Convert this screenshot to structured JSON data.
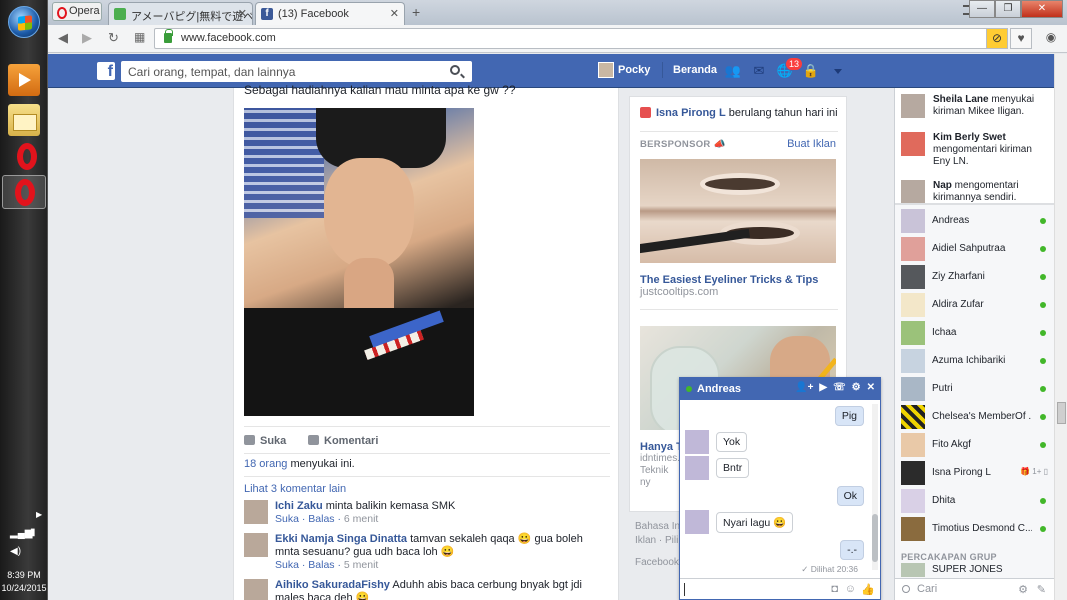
{
  "taskbar": {
    "time": "8:39 PM",
    "date": "10/24/2015"
  },
  "browser": {
    "menu_label": "Opera",
    "tabs": [
      {
        "title": "アメーバピグ|無料で遊べ"
      },
      {
        "title": "(13) Facebook"
      }
    ],
    "new_tab": "+",
    "url": "www.facebook.com"
  },
  "fb_header": {
    "logo": "f",
    "search_placeholder": "Cari orang, tempat, dan lainnya",
    "profile_name": "Pocky",
    "home_label": "Beranda",
    "notification_count": "13"
  },
  "post": {
    "caption": "Sebagai hadiahnya kalian mau minta apa ke gw ??",
    "like_label": "Suka",
    "comment_label": "Komentari",
    "likes_count": "18 orang",
    "likes_suffix": " menyukai ini.",
    "more_comments": "Lihat 3 komentar lain",
    "comments": [
      {
        "name": "Ichi Zaku",
        "text": " minta balikin kemasa SMK",
        "like": "Suka",
        "reply": "Balas",
        "time": "6 menit"
      },
      {
        "name": "Ekki Namja Singa Dinatta",
        "text": " tamvan sekaleh qaqa 😀 gua boleh mnta sesuanu? gua udh baca loh 😀",
        "like": "Suka",
        "reply": "Balas",
        "time": "5 menit"
      },
      {
        "name": "Aihiko SakuradaFishy",
        "text": " Aduhh abis baca cerbung bnyak bgt jdi males baca deh 😀"
      }
    ]
  },
  "right_column": {
    "birthday_name": "Isna Pirong L",
    "birthday_text": " berulang tahun hari ini",
    "sponsored": "BERSPONSOR",
    "create_ad": "Buat Iklan",
    "ad1_title": "The Easiest Eyeliner Tricks & Tips",
    "ad1_domain": "justcooltips.com",
    "ad2_title": "Hanya Tu",
    "ad2_domain": "idntimes.c",
    "ad2_desc": "Teknik ny praktekin",
    "footer_lang": "Bahasa In",
    "footer_links": "Iklan · Pilih",
    "footer_fb": "Facebook"
  },
  "ticker": [
    {
      "name": "Sheila Lane",
      "text": " menyukai kiriman Mikee Iligan."
    },
    {
      "name": "Kim Berly Swet",
      "text": " mengomentari kiriman Eny LN."
    },
    {
      "name": "Nap",
      "text": " mengomentari kirimannya sendiri."
    }
  ],
  "friends": [
    {
      "name": "Andreas"
    },
    {
      "name": "Aidiel Sahputraa"
    },
    {
      "name": "Ziy Zharfani"
    },
    {
      "name": "Aldira Zufar"
    },
    {
      "name": "Ichaa"
    },
    {
      "name": "Azuma Ichibariki"
    },
    {
      "name": "Putri"
    },
    {
      "name": "Chelsea's MemberOf ..."
    },
    {
      "name": "Fito Akgf"
    },
    {
      "name": "Isna Pirong L",
      "mobile": "1+"
    },
    {
      "name": "Dhita"
    },
    {
      "name": "Timotius Desmond C..."
    }
  ],
  "conversations": {
    "title": "PERCAKAPAN GRUP",
    "group": "SUPER JONES",
    "search_placeholder": "Cari"
  },
  "chat": {
    "name": "Andreas",
    "messages": [
      {
        "from": "me",
        "text": "Pig"
      },
      {
        "from": "them",
        "text": "Yok"
      },
      {
        "from": "them",
        "text": "Bntr"
      },
      {
        "from": "me",
        "text": "Ok"
      },
      {
        "from": "them",
        "text": "Nyari lagu 😀"
      },
      {
        "from": "me",
        "text": "-.-"
      }
    ],
    "seen": "✓ Dilihat 20:36"
  },
  "colors": {
    "fb_blue": "#4267b2",
    "link": "#365899",
    "online": "#42b72a",
    "badge": "#fa3e3e"
  }
}
